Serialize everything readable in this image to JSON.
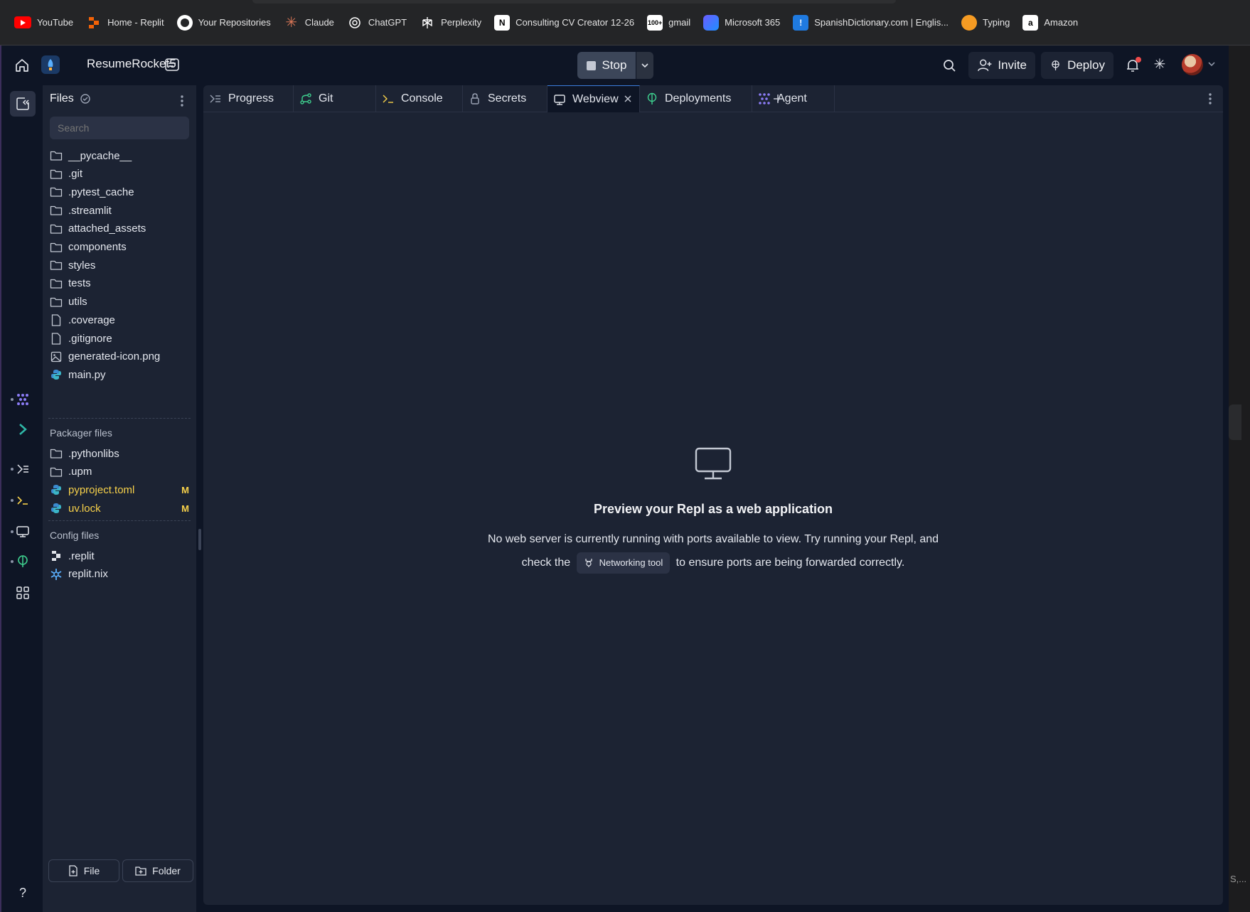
{
  "bookmarks": [
    {
      "label": "YouTube",
      "icon": "youtube-icon"
    },
    {
      "label": "Home - Replit",
      "icon": "replit-icon"
    },
    {
      "label": "Your Repositories",
      "icon": "github-icon"
    },
    {
      "label": "Claude",
      "icon": "claude-icon"
    },
    {
      "label": "ChatGPT",
      "icon": "chatgpt-icon"
    },
    {
      "label": "Perplexity",
      "icon": "perplexity-icon"
    },
    {
      "label": "Consulting CV Creator 12-26",
      "icon": "notion-icon"
    },
    {
      "label": "gmail",
      "icon": "gmail-icon"
    },
    {
      "label": "Microsoft 365",
      "icon": "microsoft365-icon"
    },
    {
      "label": "SpanishDictionary.com | Englis...",
      "icon": "spanishdict-icon"
    },
    {
      "label": "Typing",
      "icon": "typing-icon"
    },
    {
      "label": "Amazon",
      "icon": "amazon-icon"
    }
  ],
  "header": {
    "project_name": "ResumeRocket5",
    "run_label": "Stop",
    "invite_label": "Invite",
    "deploy_label": "Deploy"
  },
  "files": {
    "title": "Files",
    "search_placeholder": "Search",
    "items": [
      {
        "name": "__pycache__",
        "type": "folder"
      },
      {
        "name": ".git",
        "type": "folder"
      },
      {
        "name": ".pytest_cache",
        "type": "folder"
      },
      {
        "name": ".streamlit",
        "type": "folder"
      },
      {
        "name": "attached_assets",
        "type": "folder"
      },
      {
        "name": "components",
        "type": "folder"
      },
      {
        "name": "styles",
        "type": "folder"
      },
      {
        "name": "tests",
        "type": "folder"
      },
      {
        "name": "utils",
        "type": "folder"
      },
      {
        "name": ".coverage",
        "type": "file"
      },
      {
        "name": ".gitignore",
        "type": "file"
      },
      {
        "name": "generated-icon.png",
        "type": "image"
      },
      {
        "name": "main.py",
        "type": "python"
      }
    ],
    "packager_title": "Packager files",
    "packager_items": [
      {
        "name": ".pythonlibs",
        "type": "folder",
        "status": ""
      },
      {
        "name": ".upm",
        "type": "folder",
        "status": ""
      },
      {
        "name": "pyproject.toml",
        "type": "python",
        "status": "M"
      },
      {
        "name": "uv.lock",
        "type": "python",
        "status": "M"
      }
    ],
    "config_title": "Config files",
    "config_items": [
      {
        "name": ".replit",
        "type": "replit"
      },
      {
        "name": "replit.nix",
        "type": "nix"
      }
    ],
    "new_file_label": "File",
    "new_folder_label": "Folder"
  },
  "tabs": [
    {
      "label": "Progress",
      "icon": "progress-icon"
    },
    {
      "label": "Git",
      "icon": "git-icon"
    },
    {
      "label": "Console",
      "icon": "console-icon"
    },
    {
      "label": "Secrets",
      "icon": "lock-icon"
    },
    {
      "label": "Webview",
      "icon": "monitor-icon",
      "active": true
    },
    {
      "label": "Deployments",
      "icon": "deployments-icon"
    },
    {
      "label": "Agent",
      "icon": "agent-icon"
    }
  ],
  "webview": {
    "title": "Preview your Repl as a web application",
    "body_line1": "No web server is currently running with ports available to view. Try running your Repl, and",
    "body_pre": "check the",
    "chip_label": "Networking tool",
    "body_post": "to ensure ports are being forwarded correctly."
  },
  "help_label": "?",
  "right_strip_text": "S,...",
  "colors": {
    "app_bg": "#0e1525",
    "panel_bg": "#1c2333",
    "accent_blue": "#3b7ddd",
    "modified_yellow": "#f7d14a",
    "notification_red": "#ef4b4b"
  }
}
